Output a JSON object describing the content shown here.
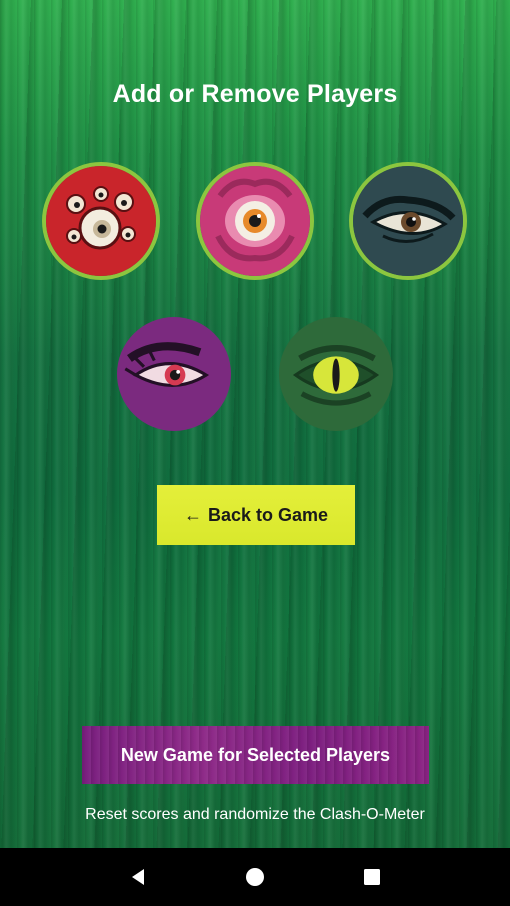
{
  "header": {
    "title": "Add or Remove Players"
  },
  "players": [
    {
      "name": "red-multi-eye-monster",
      "selected": true,
      "bg": "#c9252b"
    },
    {
      "name": "pink-tentacle-eye-monster",
      "selected": true,
      "bg": "#c83a78"
    },
    {
      "name": "dark-teal-eye-monster",
      "selected": true,
      "bg": "#2f4a50"
    },
    {
      "name": "purple-lashed-eye-monster",
      "selected": false,
      "bg": "#7b2a7f"
    },
    {
      "name": "green-reptile-eye-monster",
      "selected": false,
      "bg": "#2e6a3a"
    }
  ],
  "actions": {
    "back_arrow": "←",
    "back_label": "Back to Game",
    "new_game_label": "New Game for Selected Players",
    "new_game_hint": "Reset scores and randomize the Clash-O-Meter"
  },
  "colors": {
    "selected_ring": "#8cc63f",
    "back_button": "#dfeb34",
    "new_game_button": "#852486"
  },
  "navbar": {
    "items": [
      "back-icon",
      "home-icon",
      "recents-icon"
    ]
  }
}
